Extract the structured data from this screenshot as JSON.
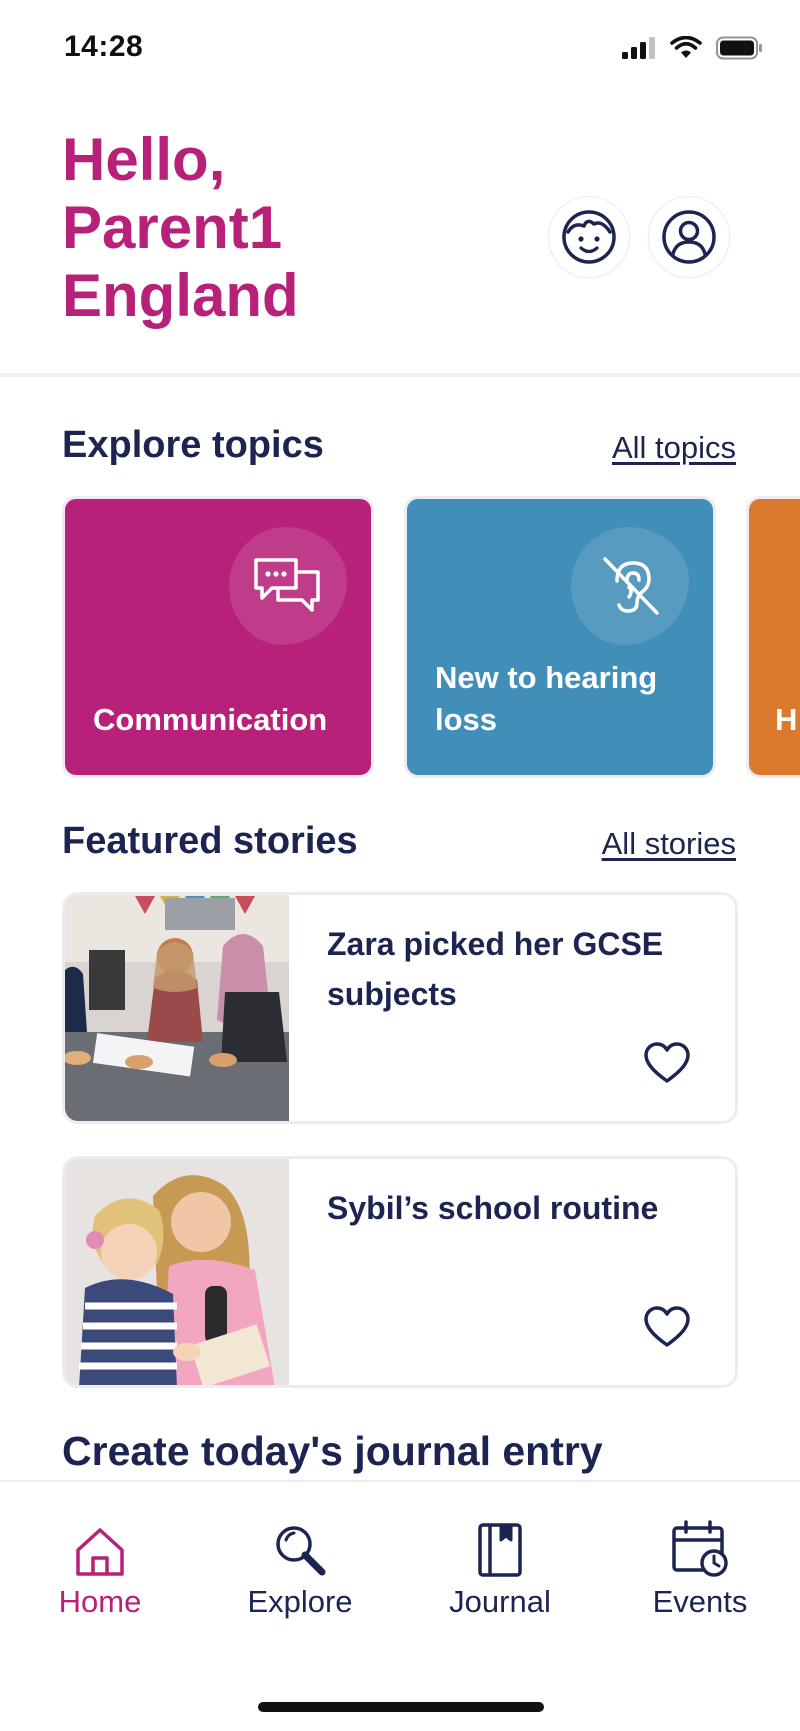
{
  "status_bar": {
    "time": "14:28"
  },
  "header": {
    "greeting_line1": "Hello,",
    "greeting_line2": "Parent1",
    "greeting_line3": "England",
    "child_button_icon": "child-face-icon",
    "profile_button_icon": "user-profile-icon"
  },
  "topics": {
    "title": "Explore topics",
    "link": "All topics",
    "items": [
      {
        "label": "Communication",
        "color": "#b7217a",
        "icon": "speech-bubbles-icon"
      },
      {
        "label": "New to hearing loss",
        "color": "#418eb9",
        "icon": "hearing-loss-icon"
      },
      {
        "label": "H",
        "color": "#d97a2f",
        "icon": ""
      }
    ]
  },
  "stories": {
    "title": "Featured stories",
    "link": "All stories",
    "items": [
      {
        "title": "Zara picked her GCSE subjects",
        "favourite_icon": "heart-outline-icon"
      },
      {
        "title": "Sybil’s school routine",
        "favourite_icon": "heart-outline-icon"
      }
    ]
  },
  "journal": {
    "title": "Create today's journal entry"
  },
  "tab_bar": {
    "active": "Home",
    "items": [
      {
        "label": "Home",
        "icon": "home-icon"
      },
      {
        "label": "Explore",
        "icon": "search-icon"
      },
      {
        "label": "Journal",
        "icon": "journal-book-icon"
      },
      {
        "label": "Events",
        "icon": "calendar-clock-icon"
      }
    ]
  },
  "colors": {
    "brand_magenta": "#b7217a",
    "navy": "#1c2452",
    "topic_blue": "#418eb9",
    "topic_orange": "#d97a2f"
  }
}
